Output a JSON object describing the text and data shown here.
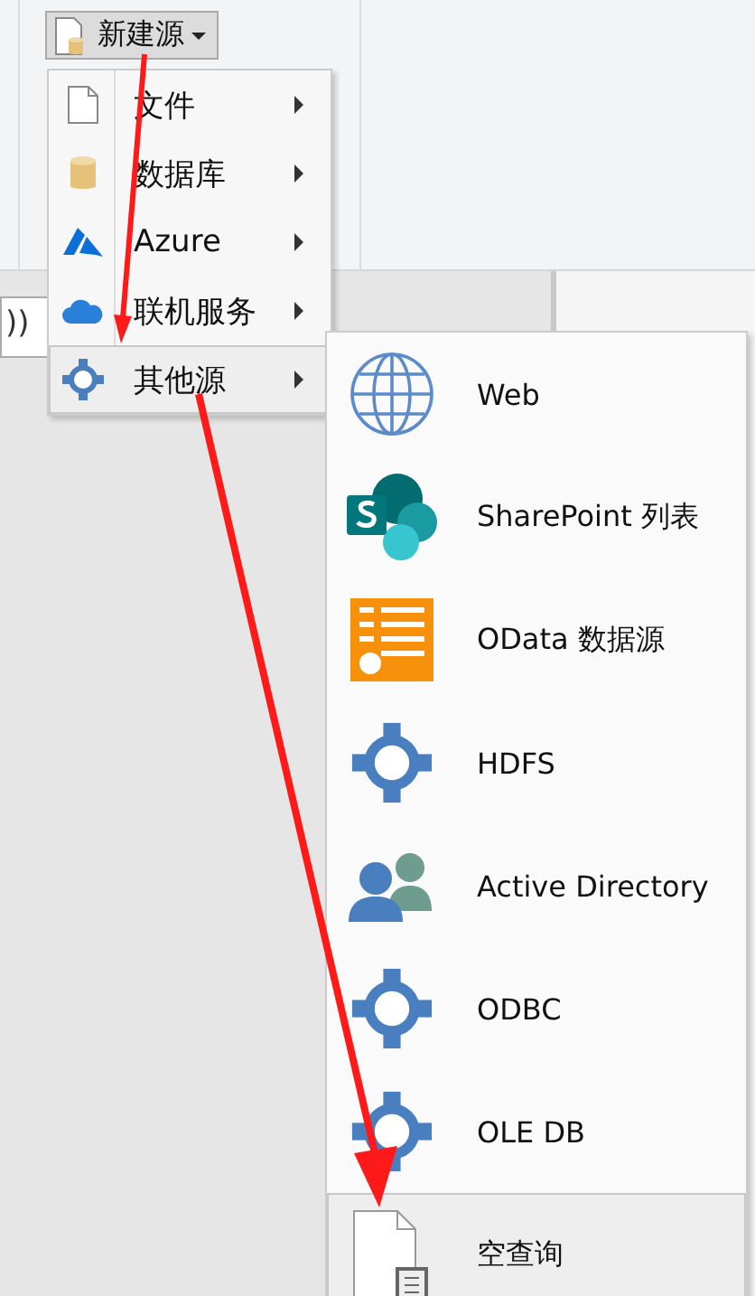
{
  "ribbon": {
    "new_source_button": {
      "label": "新建源",
      "expanded": true
    }
  },
  "formula_bar": {
    "value": "))"
  },
  "menu": {
    "items": [
      {
        "label": "文件",
        "kind": "file",
        "selected": false
      },
      {
        "label": "数据库",
        "kind": "database",
        "selected": false
      },
      {
        "label": "Azure",
        "kind": "azure",
        "selected": false
      },
      {
        "label": "联机服务",
        "kind": "cloud",
        "selected": false
      },
      {
        "label": "其他源",
        "kind": "connector",
        "selected": true
      }
    ]
  },
  "submenu": {
    "items": [
      {
        "label": "Web",
        "kind": "globe",
        "selected": false
      },
      {
        "label": "SharePoint 列表",
        "kind": "sharepoint",
        "selected": false
      },
      {
        "label": "OData 数据源",
        "kind": "odata",
        "selected": false
      },
      {
        "label": "HDFS",
        "kind": "connector",
        "selected": false
      },
      {
        "label": "Active Directory",
        "kind": "people",
        "selected": false
      },
      {
        "label": "ODBC",
        "kind": "connector",
        "selected": false
      },
      {
        "label": "OLE DB",
        "kind": "connector",
        "selected": false
      },
      {
        "label": "空查询",
        "kind": "blank-query",
        "selected": true
      }
    ]
  }
}
